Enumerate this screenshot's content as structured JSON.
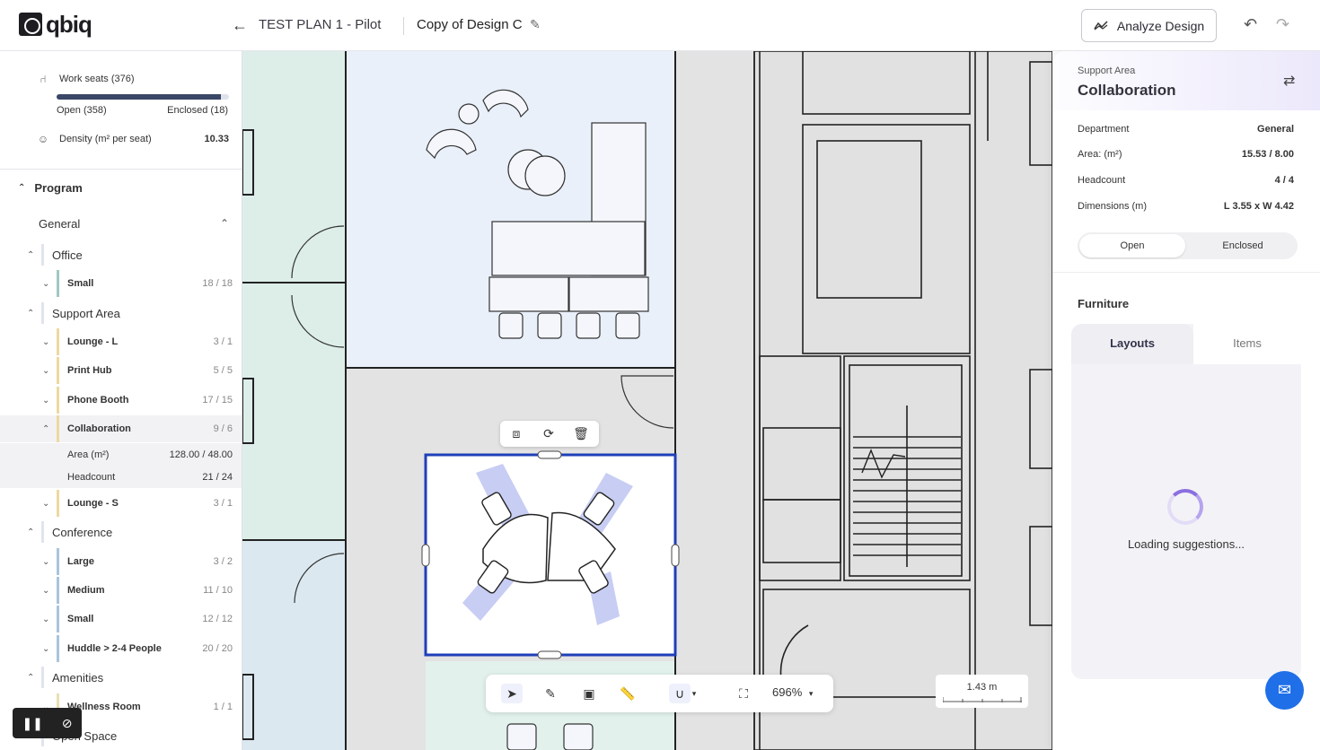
{
  "header": {
    "logo_text": "qbiq",
    "plan_name": "TEST PLAN 1 - Pilot",
    "design_name": "Copy of Design C",
    "analyze_label": "Analyze Design"
  },
  "stats": {
    "work_seats_label": "Work seats (376)",
    "open_label": "Open (358)",
    "enclosed_label": "Enclosed (18)",
    "open_fraction": 0.952,
    "density_label": "Density (m² per seat)",
    "density_value": "10.33"
  },
  "program": {
    "title": "Program",
    "group": "General",
    "categories": [
      {
        "label": "Office",
        "items": [
          {
            "label": "Small",
            "count": "18 / 18"
          }
        ]
      },
      {
        "label": "Support Area",
        "items": [
          {
            "label": "Lounge - L",
            "count": "3 / 1"
          },
          {
            "label": "Print Hub",
            "count": "5 / 5"
          },
          {
            "label": "Phone Booth",
            "count": "17 / 15"
          },
          {
            "label": "Collaboration",
            "count": "9 / 6"
          },
          {
            "label": "Lounge - S",
            "count": "3 / 1"
          }
        ]
      },
      {
        "label": "Conference",
        "items": [
          {
            "label": "Large",
            "count": "3 / 2"
          },
          {
            "label": "Medium",
            "count": "11 / 10"
          },
          {
            "label": "Small",
            "count": "12 / 12"
          },
          {
            "label": "Huddle > 2-4 People",
            "count": "20 / 20"
          }
        ]
      },
      {
        "label": "Amenities",
        "items": [
          {
            "label": "Wellness Room",
            "count": "1 / 1"
          }
        ]
      },
      {
        "label": "Open Space",
        "items": []
      }
    ],
    "selected_details": [
      {
        "label": "Area (m²)",
        "value": "128.00 / 48.00"
      },
      {
        "label": "Headcount",
        "value": "21 / 24"
      }
    ]
  },
  "canvas": {
    "zoom": "696%",
    "scale_label": "1.43 m"
  },
  "panel": {
    "type": "Support Area",
    "title": "Collaboration",
    "props": [
      {
        "label": "Department",
        "value": "General"
      },
      {
        "label": "Area: (m²)",
        "value": "15.53 / 8.00"
      },
      {
        "label": "Headcount",
        "value": "4 / 4"
      },
      {
        "label": "Dimensions (m)",
        "value": "L 3.55 x W 4.42"
      }
    ],
    "seg_open": "Open",
    "seg_enclosed": "Enclosed",
    "furniture_title": "Furniture",
    "tab_layouts": "Layouts",
    "tab_items": "Items",
    "loading_text": "Loading suggestions..."
  },
  "colors": {
    "accent": "#1f3fb8",
    "chat": "#1f6fe8",
    "office_bar": "#9fc8c4",
    "support_bar": "#ecd9a0",
    "conference_bar": "#a9c4dc",
    "amenities_bar": "#e8e0b0"
  }
}
